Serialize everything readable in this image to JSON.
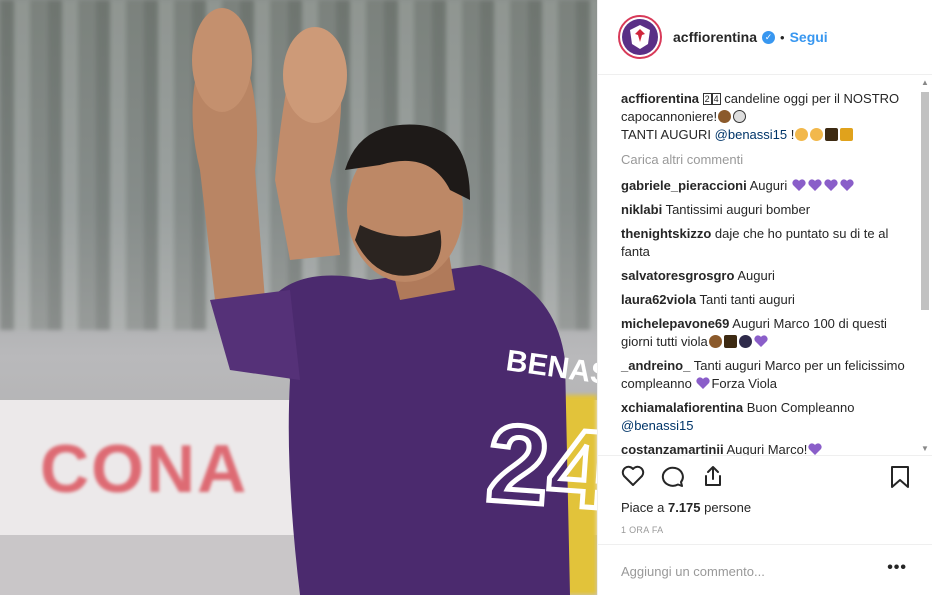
{
  "post": {
    "photo": {
      "board_text": "CONA",
      "jersey_name": "BENASSI",
      "jersey_number": "24"
    },
    "header": {
      "username": "acffiorentina",
      "dot": "•",
      "follow_label": "Segui"
    },
    "caption": {
      "username": "acffiorentina",
      "digits": [
        "2",
        "4"
      ],
      "text1": " candeline oggi per il NOSTRO capocannoniere!",
      "text2": "TANTI AUGURI ",
      "mention": "@benassi15",
      "text3": " !"
    },
    "load_more": "Carica altri commenti",
    "comments": [
      {
        "user": "gabriele_pieraccioni",
        "text": "Auguri"
      },
      {
        "user": "niklabi",
        "text": "Tantissimi auguri bomber"
      },
      {
        "user": "thenightskizzo",
        "text": "daje che ho puntato su di te al fanta"
      },
      {
        "user": "salvatoresgrosgro",
        "text": "Auguri"
      },
      {
        "user": "laura62viola",
        "text": "Tanti tanti auguri"
      },
      {
        "user": "michelepavone69",
        "text": "Auguri Marco 100 di questi giorni tutti viola"
      },
      {
        "user": "_andreino_",
        "text": "Tanti auguri Marco per un felicissimo compleanno",
        "text_after": "Forza Viola"
      },
      {
        "user": "xchiamalafiorentina",
        "text": "Buon Compleanno",
        "mention": "@benassi15"
      },
      {
        "user": "costanzamartinii",
        "text": "Auguri Marco!"
      }
    ],
    "likes": {
      "prefix": "Piace a ",
      "count": "7.175",
      "suffix": " persone"
    },
    "time": "1 ORA FA",
    "add_comment": {
      "placeholder": "Aggiungi un commento...",
      "more": "•••"
    },
    "colors": {
      "accent": "#3897f0",
      "heart": "#8a5ec9",
      "viola": "#5a2f86",
      "mention": "#003569"
    }
  }
}
